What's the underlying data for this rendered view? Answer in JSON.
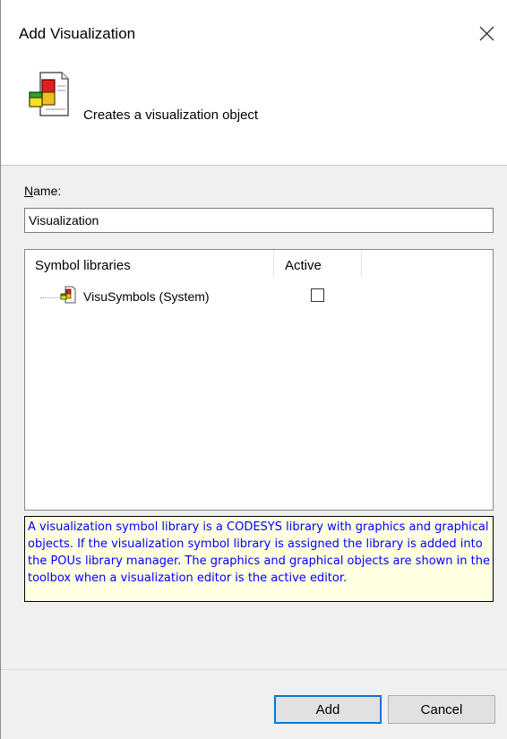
{
  "window": {
    "title": "Add Visualization",
    "close_icon": "close-icon"
  },
  "header": {
    "icon": "visualization-object-icon",
    "description": "Creates a visualization object"
  },
  "name_field": {
    "label_underlined": "N",
    "label_rest": "ame:",
    "value": "Visualization"
  },
  "libraries": {
    "columns": [
      "Symbol libraries",
      "Active"
    ],
    "rows": [
      {
        "icon": "library-icon",
        "label": "VisuSymbols (System)",
        "active": false
      }
    ]
  },
  "help_text": "A visualization symbol library is a CODESYS library with graphics and graphical objects. If the visualization symbol library is assigned the library is added into the POUs library manager. The graphics and graphical objects are shown in the toolbox when a visualization editor is the active editor.",
  "buttons": {
    "add": "Add",
    "cancel": "Cancel"
  },
  "colors": {
    "help_background": "#ffffe1",
    "help_text": "#0000ff",
    "default_button_border": "#0078d7"
  }
}
